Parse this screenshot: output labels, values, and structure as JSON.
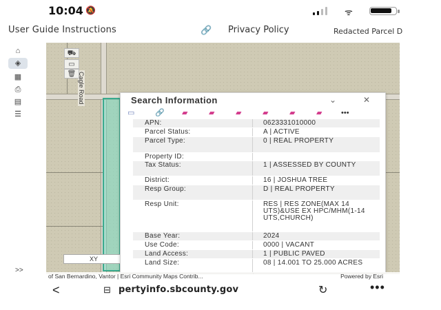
{
  "status_bar": {
    "time": "10:04",
    "battery_level": 0.85
  },
  "top_links": {
    "user_guide": "User Guide Instructions",
    "privacy_policy": "Privacy Policy",
    "redacted": "Redacted Parcel D"
  },
  "map": {
    "road_label": "Cagle Road",
    "xy_label": "XY",
    "attribution": "of San Bernardino, Vantor | Esri Community Maps Contrib...",
    "powered_by": "Powered by Esri"
  },
  "popup": {
    "title": "Search Information",
    "rows": [
      {
        "label": "APN:",
        "value": "0623331010000"
      },
      {
        "label": "Parcel Status:",
        "value": "A | ACTIVE"
      },
      {
        "label": "Parcel Type:",
        "value": "0 | REAL PROPERTY"
      },
      {
        "label": "Property ID:",
        "value": ""
      },
      {
        "label": "Tax Status:",
        "value": "1 | ASSESSED BY COUNTY"
      },
      {
        "label": "District:",
        "value": "16 | JOSHUA TREE"
      },
      {
        "label": "Resp Group:",
        "value": "D | REAL PROPERTY"
      },
      {
        "label": "Resp Unit:",
        "value": "RES | RES ZONE(MAX 14 UTS)&USE EX HPC/MHM(1-14 UTS,CHURCH)"
      },
      {
        "label": "Base Year:",
        "value": "2024"
      },
      {
        "label": "Use Code:",
        "value": "0000 | VACANT"
      },
      {
        "label": "Land Access:",
        "value": "1 | PUBLIC PAVED"
      },
      {
        "label": "Land Size:",
        "value": "08 | 14.001 TO 25.000 ACRES"
      }
    ]
  },
  "browser": {
    "url": "pertyinfo.sbcounty.gov"
  },
  "colors": {
    "parcel_highlight": "#7adcc4",
    "parcel_border": "#3aa98d",
    "marker": "#e47a35",
    "row_alt": "#efefef"
  }
}
